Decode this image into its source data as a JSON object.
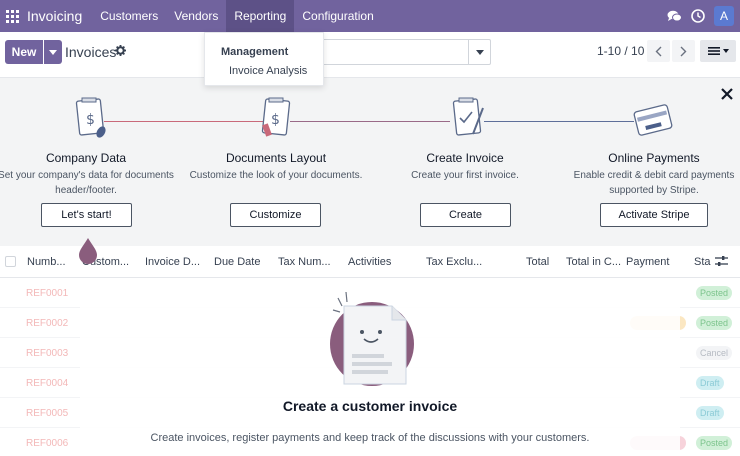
{
  "navbar": {
    "brand": "Invoicing",
    "menus": [
      "Customers",
      "Vendors",
      "Reporting",
      "Configuration"
    ],
    "active_menu": "Reporting",
    "avatar_letter": "A",
    "color": "#71639e"
  },
  "dropdown": {
    "header": "Management",
    "items": [
      "Invoice Analysis"
    ]
  },
  "control": {
    "new_label": "New",
    "title": "Invoices",
    "pager": "1-10 / 10",
    "search_placeholder": ""
  },
  "onboarding": {
    "steps": [
      {
        "title": "Company Data",
        "description": "Set your company's data for documents header/footer.",
        "button": "Let's start!",
        "icon": "document-dollar-icon"
      },
      {
        "title": "Documents Layout",
        "description": "Customize the look of your documents.",
        "button": "Customize",
        "icon": "document-layout-icon"
      },
      {
        "title": "Create Invoice",
        "description": "Create your first invoice.",
        "button": "Create",
        "icon": "invoice-check-icon"
      },
      {
        "title": "Online Payments",
        "description": "Enable credit & debit card payments supported by Stripe.",
        "button": "Activate Stripe",
        "icon": "credit-card-icon"
      }
    ]
  },
  "list": {
    "columns": [
      "Numb...",
      "Custom...",
      "Invoice D...",
      "Due Date",
      "Tax Num...",
      "Activities",
      "Tax Exclu...",
      "Total",
      "Total in C...",
      "Payment",
      "Sta"
    ],
    "rows": [
      {
        "ref": "REF0001",
        "status": "Posted"
      },
      {
        "ref": "REF0002",
        "status": "Posted"
      },
      {
        "ref": "REF0003",
        "status": "Cancel"
      },
      {
        "ref": "REF0004",
        "status": "Draft"
      },
      {
        "ref": "REF0005",
        "status": "Draft"
      },
      {
        "ref": "REF0006",
        "status": "Posted"
      }
    ]
  },
  "help": {
    "title": "Create a customer invoice",
    "description": "Create invoices, register payments and keep track of the discussions with your customers."
  }
}
